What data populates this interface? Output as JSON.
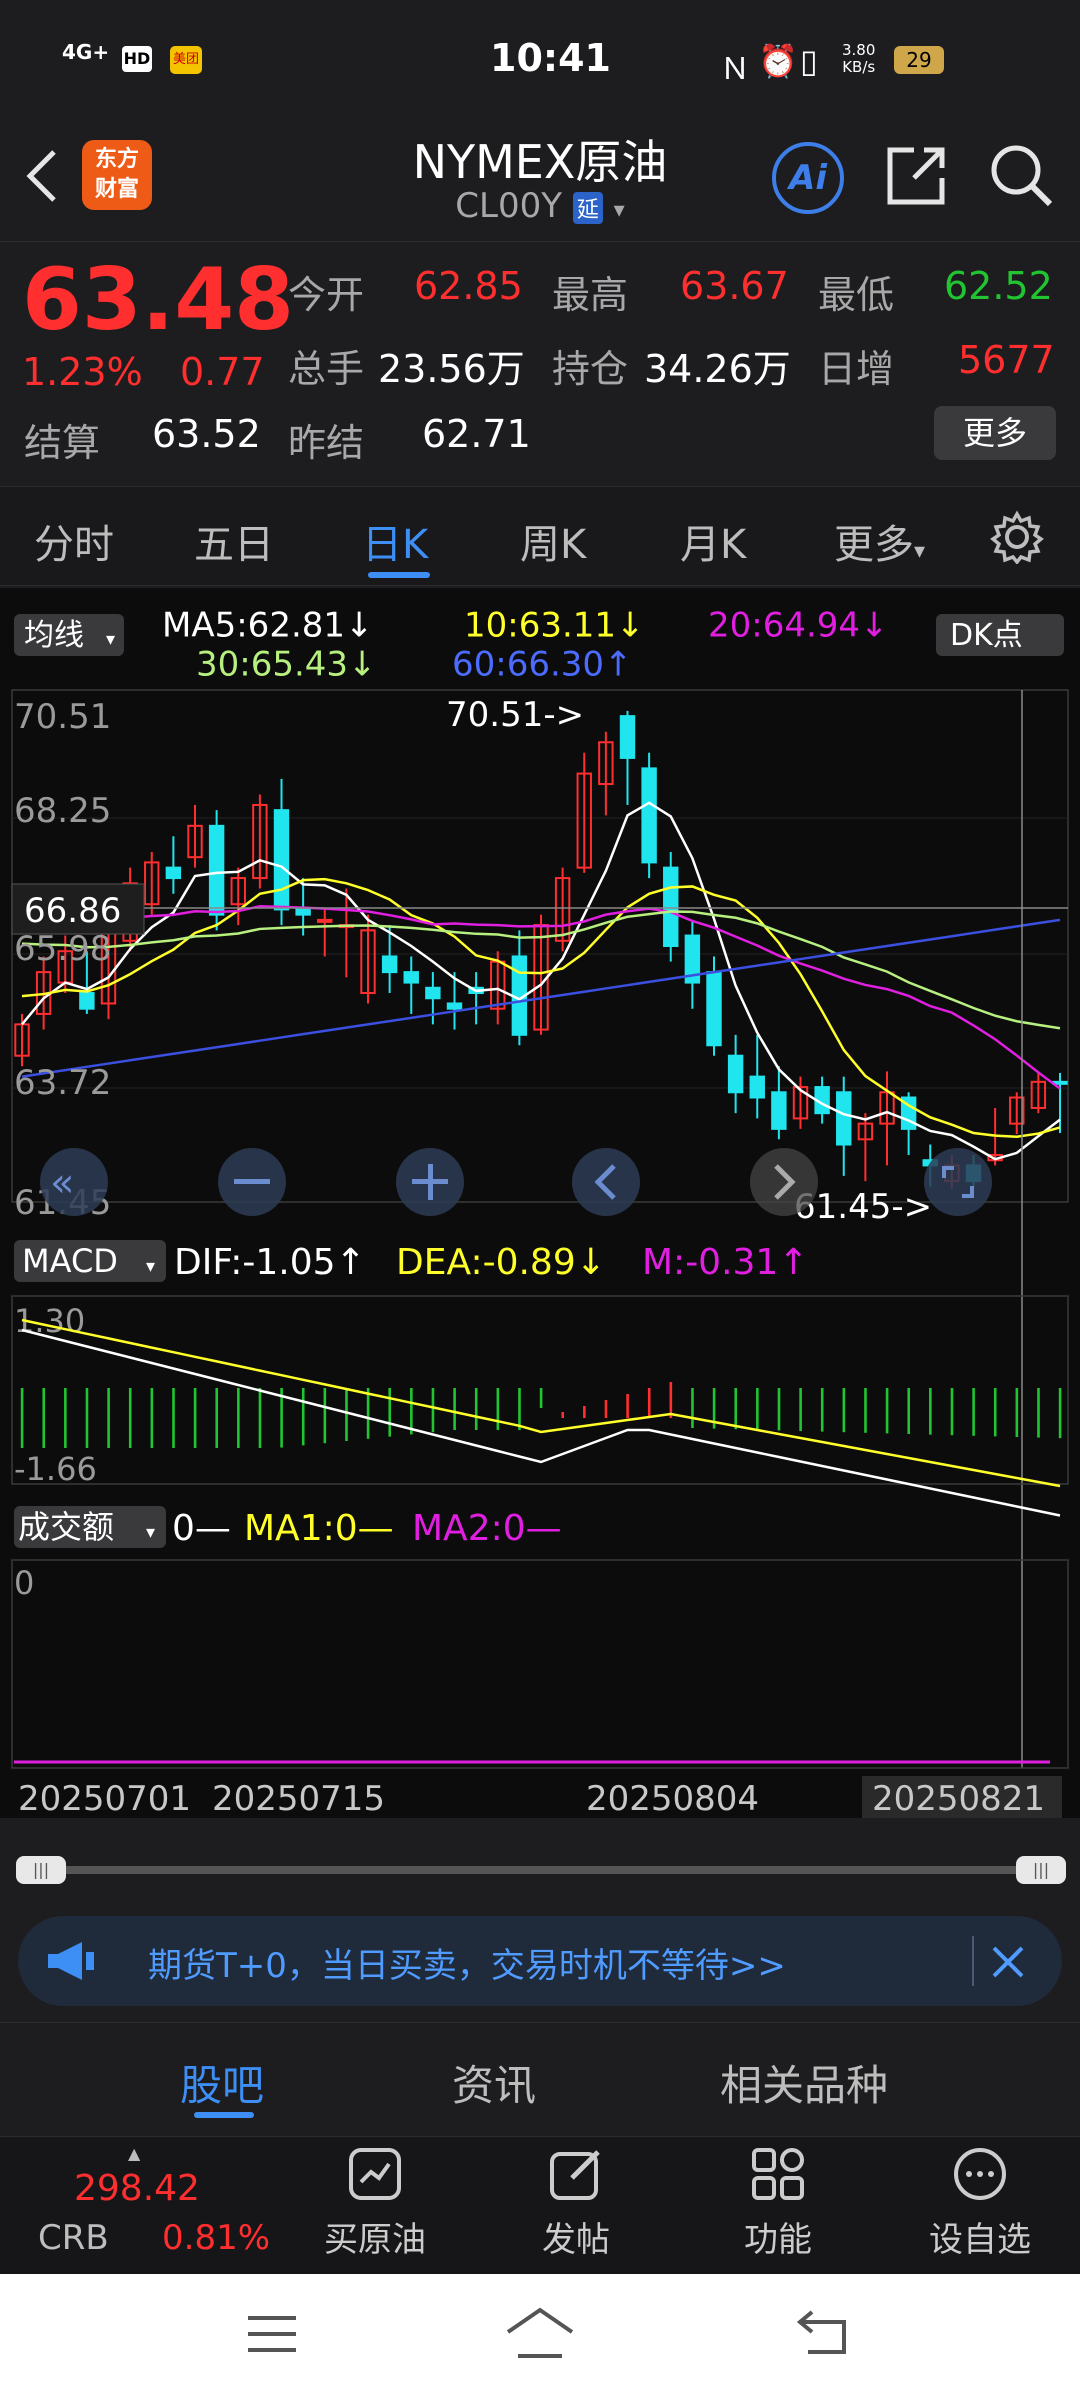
{
  "status": {
    "time": "10:41",
    "signal": "4G+",
    "hd": "HD",
    "meituan": "美团",
    "speed": "3.80",
    "speed_unit": "KB/s",
    "battery": "29"
  },
  "header": {
    "logo_line1": "东方",
    "logo_line2": "财富",
    "title": "NYMEX原油",
    "code": "CL00Y",
    "delay_badge": "延",
    "ai": "Ai"
  },
  "quote": {
    "price": "63.48",
    "change_pct": "1.23%",
    "change": "0.77",
    "open_label": "今开",
    "open": "62.85",
    "high_label": "最高",
    "high": "63.67",
    "low_label": "最低",
    "low": "62.52",
    "vol_label": "总手",
    "vol": "23.56万",
    "oi_label": "持仓",
    "oi": "34.26万",
    "oi_chg_label": "日增",
    "oi_chg": "5677",
    "settle_label": "结算",
    "settle": "63.52",
    "prev_label": "昨结",
    "prev": "62.71",
    "more": "更多"
  },
  "tabs": [
    "分时",
    "五日",
    "日K",
    "周K",
    "月K",
    "更多"
  ],
  "active_tab": "日K",
  "ma": {
    "selector": "均线",
    "ma5": "MA5:62.81↓",
    "ma10": "10:63.11↓",
    "ma20": "20:64.94↓",
    "ma30": "30:65.43↓",
    "ma60": "60:66.30↑",
    "dk": "DK点"
  },
  "price_axis": [
    "70.51",
    "68.25",
    "65.98",
    "63.72",
    "61.45"
  ],
  "crosshair_label": "66.86",
  "annot_high": "70.51->",
  "annot_low": "61.45->",
  "macd": {
    "selector": "MACD",
    "dif": "DIF:-1.05↑",
    "dea": "DEA:-0.89↓",
    "m": "M:-0.31↑",
    "top": "1.30",
    "bottom": "-1.66"
  },
  "volume": {
    "selector": "成交额",
    "val": "0—",
    "ma1": "MA1:0—",
    "ma2": "MA2:0—",
    "axis0": "0"
  },
  "dates": [
    "20250701",
    "20250715",
    "20250804",
    "20250821"
  ],
  "promo": "期货T+0，当日买卖，交易时机不等待>>",
  "subtabs": [
    "股吧",
    "资讯",
    "相关品种"
  ],
  "bottom": {
    "crb_value": "298.42",
    "crb_label": "CRB",
    "crb_pct": "0.81%",
    "buy": "买原油",
    "post": "发帖",
    "func": "功能",
    "watch": "设自选"
  },
  "colors": {
    "up": "#ff2f2f",
    "down": "#21e5ee",
    "ma5": "#ffffff",
    "ma10": "#ffff2a",
    "ma20": "#e01fe0",
    "ma30": "#b8f080",
    "ma60": "#3b4fe0",
    "dif": "#ffffff",
    "dea": "#ffff2a"
  }
}
